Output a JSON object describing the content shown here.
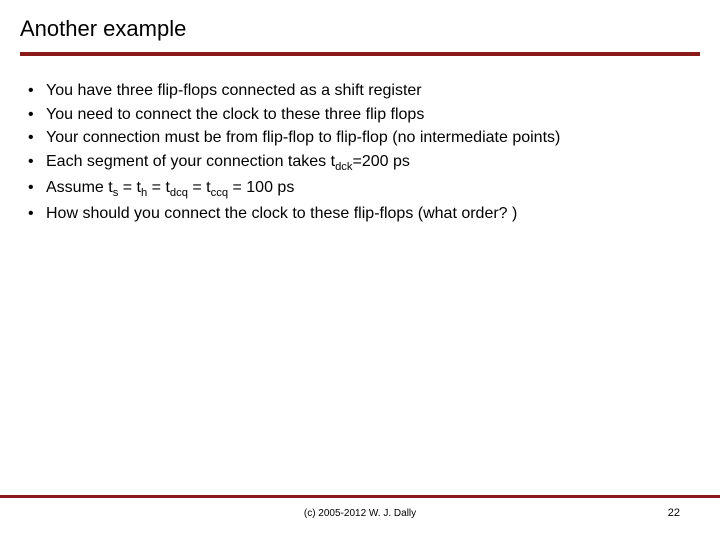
{
  "title": "Another example",
  "bullets": [
    {
      "pre": "You have three flip-flops connected as a shift register"
    },
    {
      "pre": "You need to connect the clock to these three flip flops"
    },
    {
      "pre": "Your connection must be from flip-flop to flip-flop (no intermediate points)"
    },
    {
      "pre": "Each segment of your connection takes t",
      "sub1": "dck",
      "mid": "=200 ps"
    },
    {
      "pre": "Assume t",
      "sub1": "s",
      "mid": " = t",
      "sub2": "h",
      "mid2": " = t",
      "sub3": "dcq",
      "mid3": " = t",
      "sub4": "ccq",
      "post": " = 100 ps"
    },
    {
      "pre": "How should you connect the clock to these flip-flops (what order? )"
    }
  ],
  "copyright": "(c) 2005-2012 W. J. Dally",
  "page_number": "22"
}
